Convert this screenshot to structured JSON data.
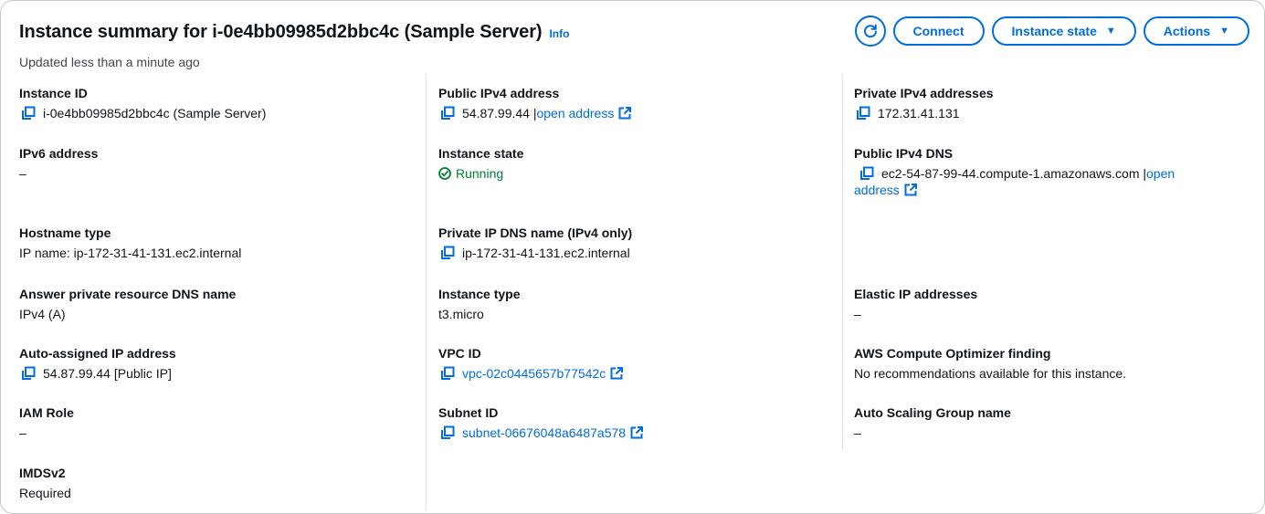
{
  "header": {
    "title": "Instance summary for i-0e4bb09985d2bbc4c (Sample Server)",
    "info": "Info",
    "updated": "Updated less than a minute ago"
  },
  "buttons": {
    "refresh_icon": "refresh-icon",
    "connect": "Connect",
    "instance_state": "Instance state",
    "actions": "Actions"
  },
  "fields": {
    "instance_id": {
      "label": "Instance ID",
      "value": "i-0e4bb09985d2bbc4c (Sample Server)"
    },
    "ipv6": {
      "label": "IPv6 address",
      "value": "–"
    },
    "hostname_type": {
      "label": "Hostname type",
      "value": "IP name: ip-172-31-41-131.ec2.internal"
    },
    "answer_dns": {
      "label": "Answer private resource DNS name",
      "value": "IPv4 (A)"
    },
    "auto_ip": {
      "label": "Auto-assigned IP address",
      "value": "54.87.99.44 [Public IP]"
    },
    "iam_role": {
      "label": "IAM Role",
      "value": "–"
    },
    "imdsv2": {
      "label": "IMDSv2",
      "value": "Required"
    },
    "public_ipv4": {
      "label": "Public IPv4 address",
      "value": "54.87.99.44 |",
      "link": "open address"
    },
    "instance_state": {
      "label": "Instance state",
      "value": "Running"
    },
    "private_dns": {
      "label": "Private IP DNS name (IPv4 only)",
      "value": "ip-172-31-41-131.ec2.internal"
    },
    "instance_type": {
      "label": "Instance type",
      "value": "t3.micro"
    },
    "vpc_id": {
      "label": "VPC ID",
      "value": "vpc-02c0445657b77542c"
    },
    "subnet_id": {
      "label": "Subnet ID",
      "value": "subnet-06676048a6487a578"
    },
    "private_ipv4": {
      "label": "Private IPv4 addresses",
      "value": "172.31.41.131"
    },
    "public_dns": {
      "label": "Public IPv4 DNS",
      "value": "ec2-54-87-99-44.compute-1.amazonaws.com |",
      "link_1": "open",
      "link_2": "address"
    },
    "elastic_ip": {
      "label": "Elastic IP addresses",
      "value": "–"
    },
    "optimizer": {
      "label": "AWS Compute Optimizer finding",
      "value": "No recommendations available for this instance."
    },
    "asg": {
      "label": "Auto Scaling Group name",
      "value": "–"
    }
  },
  "colors": {
    "link": "#006ce0",
    "running": "#00802f",
    "border": "#c6c6cd",
    "divider": "#e1e1e5"
  }
}
